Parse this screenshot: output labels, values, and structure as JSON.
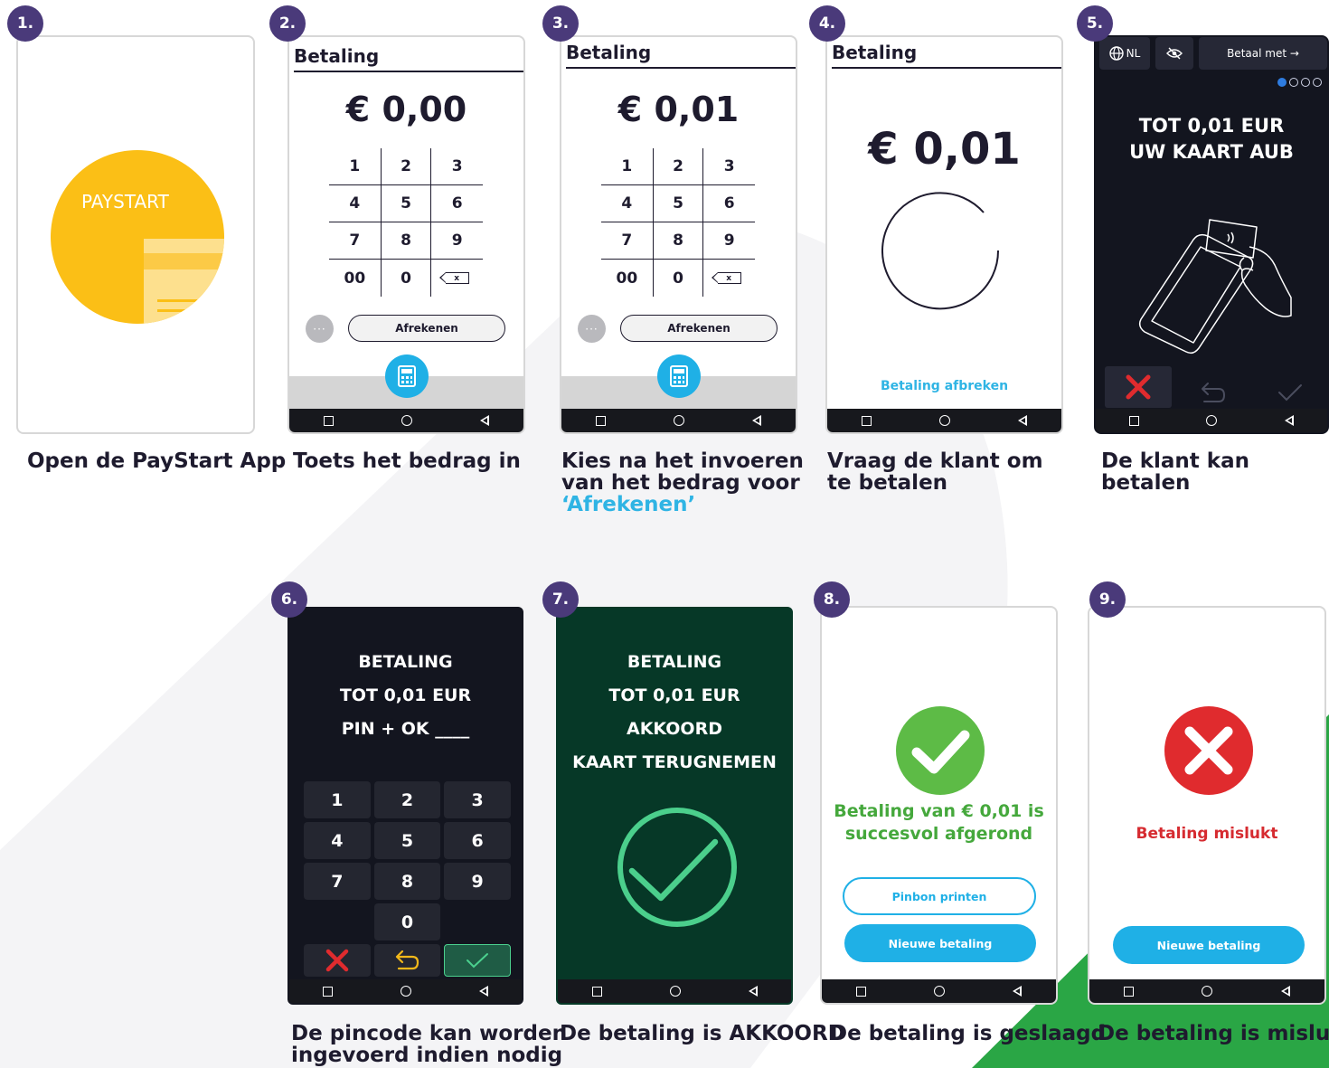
{
  "steps": [
    {
      "number": "1.",
      "caption": "Open de PayStart App"
    },
    {
      "number": "2.",
      "caption": "Toets het bedrag in"
    },
    {
      "number": "3.",
      "caption_lines": [
        "Kies na het invoeren",
        "van het bedrag voor"
      ],
      "caption_highlight": "‘Afrekenen’"
    },
    {
      "number": "4.",
      "caption_lines": [
        "Vraag de klant om",
        "te betalen"
      ]
    },
    {
      "number": "5.",
      "caption": "De klant kan betalen"
    },
    {
      "number": "6.",
      "caption_lines": [
        "De pincode kan worden",
        "ingevoerd indien nodig"
      ]
    },
    {
      "number": "7.",
      "caption": "De betaling is AKKOORD"
    },
    {
      "number": "8.",
      "caption": "De betaling is geslaagd"
    },
    {
      "number": "9.",
      "caption": "De betaling is mislukt."
    }
  ],
  "app_logo_text": "PAYSTART",
  "payment_screen": {
    "title": "Betaling",
    "amount_initial": "€ 0,00",
    "amount_entered": "€ 0,01",
    "keys": [
      "1",
      "2",
      "3",
      "4",
      "5",
      "6",
      "7",
      "8",
      "9",
      "00",
      "0"
    ],
    "backspace_glyph": "x",
    "more_glyph": "···",
    "checkout_label": "Afrekenen"
  },
  "waiting_screen": {
    "title": "Betaling",
    "amount": "€ 0,01",
    "cancel_label": "Betaling afbreken"
  },
  "card_screen": {
    "language": "NL",
    "pay_with_label": "Betaal met →",
    "line1": "TOT 0,01 EUR",
    "line2": "UW KAART AUB"
  },
  "pin_screen": {
    "lines": [
      "BETALING",
      "TOT 0,01  EUR",
      "PIN + OK ____"
    ],
    "keys": [
      "1",
      "2",
      "3",
      "4",
      "5",
      "6",
      "7",
      "8",
      "9",
      "0"
    ]
  },
  "approved_screen": {
    "lines": [
      "BETALING",
      "TOT 0,01  EUR",
      "AKKOORD",
      "KAART TERUGNEMEN"
    ]
  },
  "success_screen": {
    "message_line1": "Betaling van € 0,01 is",
    "message_line2": "succesvol afgerond",
    "print_label": "Pinbon printen",
    "new_label": "Nieuwe betaling"
  },
  "failed_screen": {
    "message": "Betaling mislukt",
    "new_label": "Nieuwe betaling"
  },
  "colors": {
    "badge": "#4a3a7a",
    "accent_blue": "#1fb0e6",
    "brand_yellow": "#fbbf16",
    "success_green": "#5dbb46",
    "fail_red": "#e02b2e",
    "approved_bg": "#063827",
    "terminal_bg": "#13151f"
  },
  "icons": {
    "nav_square": "square-icon",
    "nav_circle": "circle-icon",
    "nav_back": "back-triangle-icon",
    "calculator": "calculator-icon",
    "globe": "globe-icon",
    "eye": "eye-off-icon",
    "card_tap": "card-tap-illustration",
    "cancel": "cross-icon",
    "undo": "undo-icon",
    "confirm": "check-icon"
  }
}
